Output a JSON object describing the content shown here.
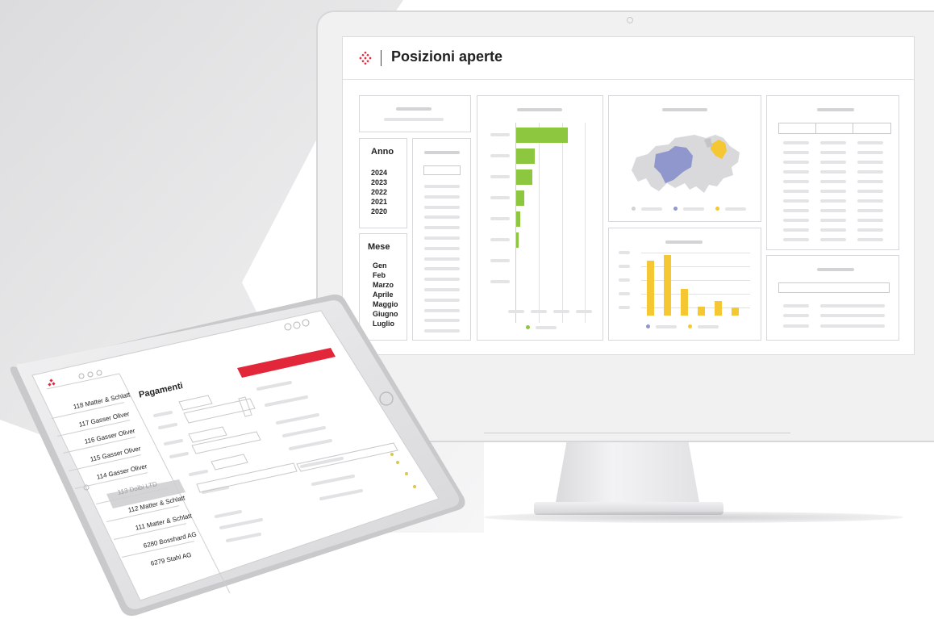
{
  "monitor": {
    "app_title": "Posizioni aperte",
    "filters": {
      "year": {
        "heading": "Anno",
        "items": [
          "2024",
          "2023",
          "2022",
          "2021",
          "2020"
        ]
      },
      "month": {
        "heading": "Mese",
        "items": [
          "Gen",
          "Feb",
          "Marzo",
          "Aprile",
          "Maggio",
          "Giugno",
          "Luglio"
        ]
      }
    },
    "colors": {
      "green": "#8dc63f",
      "yellow": "#f5c732",
      "purple": "#9097cc",
      "brand_red": "#e2273a"
    }
  },
  "tablet": {
    "app_title": "Pagamenti",
    "list": [
      "118 Matter & Schlatt",
      "117 Gasser Oliver",
      "116 Gasser Oliver",
      "115 Gasser Oliver",
      "114 Gasser Oliver",
      "113 Dolbi LTD",
      "112 Matter & Schlatt",
      "111 Matter & Schlatt",
      "6280 Bosshard AG",
      "6279 Stahl AG"
    ],
    "selected_index": 5
  }
}
